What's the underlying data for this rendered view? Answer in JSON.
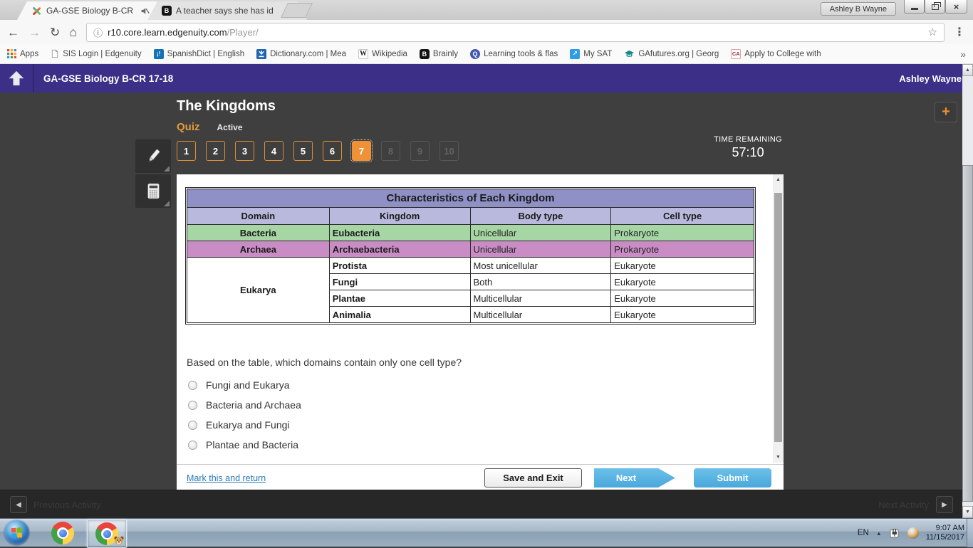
{
  "browser": {
    "tabs": [
      {
        "title": "GA-GSE Biology B-CR"
      },
      {
        "title": "A teacher says she has id"
      }
    ],
    "profile_name": "Ashley B Wayne",
    "nav": {
      "url_host": "r10.core.learn.edgenuity.com",
      "url_path": "/Player/"
    },
    "bookmarks": [
      {
        "label": "Apps"
      },
      {
        "label": "SIS Login | Edgenuity"
      },
      {
        "label": "SpanishDict | English"
      },
      {
        "label": "Dictionary.com | Mea"
      },
      {
        "label": "Wikipedia"
      },
      {
        "label": "Brainly"
      },
      {
        "label": "Learning tools & flas"
      },
      {
        "label": "My SAT"
      },
      {
        "label": "GAfutures.org | Georg"
      },
      {
        "label": "Apply to College with"
      }
    ],
    "bookmarks_overflow": "»"
  },
  "header": {
    "course_title": "GA-GSE Biology B-CR 17-18",
    "user_name": "Ashley Wayne"
  },
  "lesson": {
    "title": "The Kingdoms",
    "activity_type": "Quiz",
    "activity_status": "Active",
    "question_numbers": [
      "1",
      "2",
      "3",
      "4",
      "5",
      "6",
      "7",
      "8",
      "9",
      "10"
    ],
    "current_question": "7",
    "timer_label": "TIME REMAINING",
    "timer_value": "57:10",
    "add_button": "+"
  },
  "quiz": {
    "table": {
      "title": "Characteristics of Each Kingdom",
      "headers": [
        "Domain",
        "Kingdom",
        "Body type",
        "Cell type"
      ],
      "rows": [
        {
          "domain": "Bacteria",
          "kingdom": "Eubacteria",
          "body": "Unicellular",
          "cell": "Prokaryote"
        },
        {
          "domain": "Archaea",
          "kingdom": "Archaebacteria",
          "body": "Unicellular",
          "cell": "Prokaryote"
        },
        {
          "domain": "Eukarya",
          "kingdom": "Protista",
          "body": "Most unicellular",
          "cell": "Eukaryote"
        },
        {
          "kingdom": "Fungi",
          "body": "Both",
          "cell": "Eukaryote"
        },
        {
          "kingdom": "Plantae",
          "body": "Multicellular",
          "cell": "Eukaryote"
        },
        {
          "kingdom": "Animalia",
          "body": "Multicellular",
          "cell": "Eukaryote"
        }
      ]
    },
    "question": "Based on the table, which domains contain only one cell type?",
    "options": [
      "Fungi and Eukarya",
      "Bacteria and Archaea",
      "Eukarya and Fungi",
      "Plantae and Bacteria"
    ],
    "footer": {
      "mark_link": "Mark this and return",
      "save_exit": "Save and Exit",
      "next": "Next",
      "submit": "Submit"
    }
  },
  "activity_nav": {
    "previous": "Previous Activity",
    "next": "Next Activity"
  },
  "taskbar": {
    "language": "EN",
    "time": "9:07 AM",
    "date": "11/15/2017"
  },
  "colors": {
    "purple_header": "#3b2f87",
    "accent_orange": "#ef9237",
    "button_blue": "#57b1e0",
    "table_title_bg": "#8f90c5",
    "table_header_bg": "#b8b9dc",
    "row_green": "#a7d6a5",
    "row_pink": "#c98cc5"
  }
}
